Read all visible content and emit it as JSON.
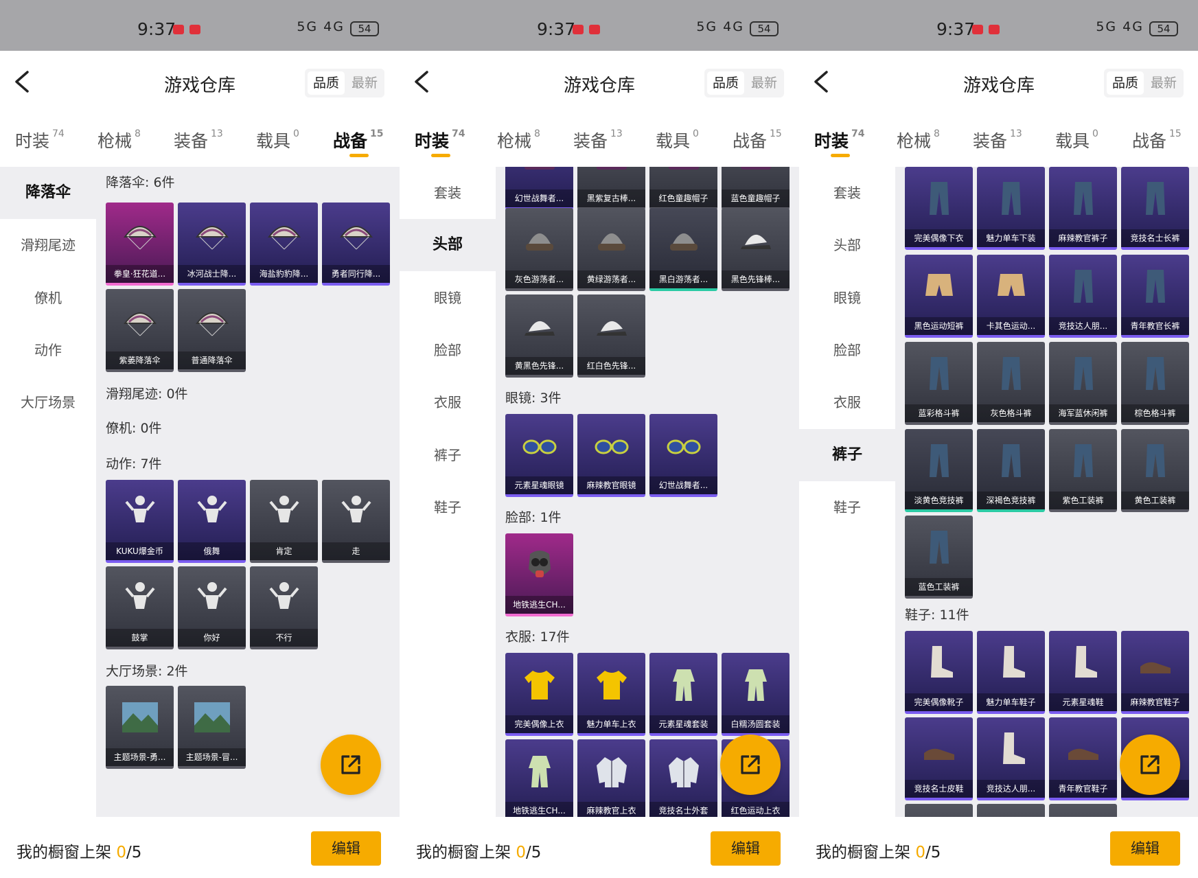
{
  "status_bar": {
    "time": "9:37",
    "signal": "5G 4G",
    "battery": "54"
  },
  "header": {
    "title": "游戏仓库",
    "sort_quality": "品质",
    "sort_latest": "最新"
  },
  "tabs": [
    {
      "label": "时装",
      "count": "74"
    },
    {
      "label": "枪械",
      "count": "8"
    },
    {
      "label": "装备",
      "count": "13"
    },
    {
      "label": "载具",
      "count": "0"
    },
    {
      "label": "战备",
      "count": "15"
    }
  ],
  "footer": {
    "label": "我的橱窗上架 ",
    "count": "0",
    "total": "/5",
    "edit": "编辑"
  },
  "colors": {
    "accent": "#f6ab00",
    "content_bg": "#eeeef1",
    "status_bar": "#a6a6a9",
    "rarity_purple": "#7a5cf0",
    "rarity_pink": "#f26bd0",
    "rarity_green": "#2bcaa4"
  },
  "screens": [
    {
      "active_tab": 4,
      "sidebar": [
        "降落伞",
        "滑翔尾迹",
        "僚机",
        "动作",
        "大厅场景"
      ],
      "active_side": 0,
      "sections": [
        "降落伞: 6件",
        "滑翔尾迹: 0件",
        "僚机: 0件",
        "动作: 7件",
        "大厅场景: 2件"
      ],
      "cards": [
        {
          "label": "拳皇·狂花道...",
          "rarity": "pnk",
          "icon": "parachute-icon"
        },
        {
          "label": "冰河战士降...",
          "rarity": "pur",
          "icon": "parachute-icon"
        },
        {
          "label": "海盐豹豹降...",
          "rarity": "pur",
          "icon": "parachute-icon"
        },
        {
          "label": "勇者同行降...",
          "rarity": "pur",
          "icon": "parachute-icon"
        },
        {
          "label": "紫萎降落伞",
          "rarity": "gry",
          "icon": "parachute-icon"
        },
        {
          "label": "普通降落伞",
          "rarity": "gry",
          "icon": "parachute-icon"
        },
        {
          "label": "KUKU爆金币",
          "rarity": "pur",
          "icon": "emote-icon"
        },
        {
          "label": "俄舞",
          "rarity": "pur",
          "icon": "emote-icon"
        },
        {
          "label": "肯定",
          "rarity": "gry",
          "icon": "emote-icon"
        },
        {
          "label": "走",
          "rarity": "gry",
          "icon": "emote-icon"
        },
        {
          "label": "鼓掌",
          "rarity": "gry",
          "icon": "emote-icon"
        },
        {
          "label": "你好",
          "rarity": "gry",
          "icon": "emote-icon"
        },
        {
          "label": "不行",
          "rarity": "gry",
          "icon": "emote-icon"
        },
        {
          "label": "主题场景-勇...",
          "rarity": "gry",
          "icon": "scene-icon"
        },
        {
          "label": "主题场景-冒...",
          "rarity": "gry",
          "icon": "scene-icon"
        }
      ]
    },
    {
      "active_tab": 0,
      "sidebar": [
        "套装",
        "头部",
        "眼镜",
        "脸部",
        "衣服",
        "裤子",
        "鞋子"
      ],
      "active_side": 1,
      "sections": [
        "眼镜: 3件",
        "脸部: 1件",
        "衣服: 17件"
      ],
      "cards": [
        {
          "label": "幻世战舞者...",
          "rarity": "pur",
          "icon": "hat-icon"
        },
        {
          "label": "黑紫复古棒...",
          "rarity": "gry",
          "icon": "hat-icon"
        },
        {
          "label": "红色童趣帽子",
          "rarity": "gry",
          "icon": "hat-icon"
        },
        {
          "label": "蓝色童趣帽子",
          "rarity": "gry",
          "icon": "hat-icon"
        },
        {
          "label": "灰色游荡者...",
          "rarity": "gry",
          "icon": "beanie-icon"
        },
        {
          "label": "黄绿游荡者...",
          "rarity": "gry",
          "icon": "beanie-icon"
        },
        {
          "label": "黑白游荡者...",
          "rarity": "grn",
          "icon": "beanie-icon"
        },
        {
          "label": "黑色先锋棒...",
          "rarity": "gry",
          "icon": "cap-icon"
        },
        {
          "label": "黄黑色先锋...",
          "rarity": "gry",
          "icon": "cap-icon"
        },
        {
          "label": "红白色先锋...",
          "rarity": "gry",
          "icon": "cap-icon"
        },
        {
          "label": "元素星魂眼镜",
          "rarity": "pur",
          "icon": "glasses-icon"
        },
        {
          "label": "麻辣教官眼镜",
          "rarity": "pur",
          "icon": "glasses-icon"
        },
        {
          "label": "幻世战舞者...",
          "rarity": "pur",
          "icon": "glasses-icon"
        },
        {
          "label": "地铁逃生CH...",
          "rarity": "pnk",
          "icon": "gas-mask-icon"
        },
        {
          "label": "完美偶像上衣",
          "rarity": "pur",
          "icon": "shirt-icon"
        },
        {
          "label": "魅力单车上衣",
          "rarity": "pur",
          "icon": "shirt-icon"
        },
        {
          "label": "元素星魂套装",
          "rarity": "pur",
          "icon": "outfit-icon"
        },
        {
          "label": "白糯汤圆套装",
          "rarity": "pur",
          "icon": "outfit-icon"
        },
        {
          "label": "地铁逃生CH...",
          "rarity": "pur",
          "icon": "outfit-icon"
        },
        {
          "label": "麻辣教官上衣",
          "rarity": "pur",
          "icon": "jacket-icon"
        },
        {
          "label": "竞技名士外套",
          "rarity": "pur",
          "icon": "jacket-icon"
        },
        {
          "label": "红色运动上衣",
          "rarity": "pur",
          "icon": "jacket-icon"
        }
      ]
    },
    {
      "active_tab": 0,
      "sidebar": [
        "套装",
        "头部",
        "眼镜",
        "脸部",
        "衣服",
        "裤子",
        "鞋子"
      ],
      "active_side": 5,
      "sections": [
        "鞋子: 11件"
      ],
      "cards": [
        {
          "label": "完美偶像下衣",
          "rarity": "pur",
          "icon": "pants-icon"
        },
        {
          "label": "魅力单车下装",
          "rarity": "pur",
          "icon": "pants-icon"
        },
        {
          "label": "麻辣教官裤子",
          "rarity": "pur",
          "icon": "pants-icon"
        },
        {
          "label": "竞技名士长裤",
          "rarity": "pur",
          "icon": "pants-icon"
        },
        {
          "label": "黑色运动短裤",
          "rarity": "pur",
          "icon": "shorts-icon"
        },
        {
          "label": "卡其色运动...",
          "rarity": "pur",
          "icon": "shorts-icon"
        },
        {
          "label": "竞技达人朋...",
          "rarity": "pur",
          "icon": "pants-icon"
        },
        {
          "label": "青年教官长裤",
          "rarity": "pur",
          "icon": "pants-icon"
        },
        {
          "label": "蓝彩格斗裤",
          "rarity": "gry",
          "icon": "pants-icon"
        },
        {
          "label": "灰色格斗裤",
          "rarity": "gry",
          "icon": "pants-icon"
        },
        {
          "label": "海军蓝休闲裤",
          "rarity": "gry",
          "icon": "pants-icon"
        },
        {
          "label": "棕色格斗裤",
          "rarity": "gry",
          "icon": "pants-icon"
        },
        {
          "label": "淡黄色竞技裤",
          "rarity": "grn",
          "icon": "pants-icon"
        },
        {
          "label": "深褐色竞技裤",
          "rarity": "grn",
          "icon": "pants-icon"
        },
        {
          "label": "紫色工装裤",
          "rarity": "gry",
          "icon": "pants-icon"
        },
        {
          "label": "黄色工装裤",
          "rarity": "gry",
          "icon": "pants-icon"
        },
        {
          "label": "蓝色工装裤",
          "rarity": "gry",
          "icon": "pants-icon"
        },
        {
          "label": "完美偶像靴子",
          "rarity": "pur",
          "icon": "boot-icon"
        },
        {
          "label": "魅力单车鞋子",
          "rarity": "pur",
          "icon": "boot-icon"
        },
        {
          "label": "元素星魂鞋",
          "rarity": "pur",
          "icon": "boot-icon"
        },
        {
          "label": "麻辣教官鞋子",
          "rarity": "pur",
          "icon": "shoe-icon"
        },
        {
          "label": "竞技名士皮鞋",
          "rarity": "pur",
          "icon": "shoe-icon"
        },
        {
          "label": "竞技达人朋...",
          "rarity": "pur",
          "icon": "boot-icon"
        },
        {
          "label": "青年教官鞋子",
          "rarity": "pur",
          "icon": "shoe-icon"
        },
        {
          "label": "...鞋",
          "rarity": "pur",
          "icon": "shoe-icon"
        },
        {
          "label": "",
          "rarity": "gry",
          "icon": "shoe-icon"
        },
        {
          "label": "",
          "rarity": "gry",
          "icon": "shoe-icon"
        },
        {
          "label": "",
          "rarity": "gry",
          "icon": "shoe-icon"
        }
      ]
    }
  ]
}
